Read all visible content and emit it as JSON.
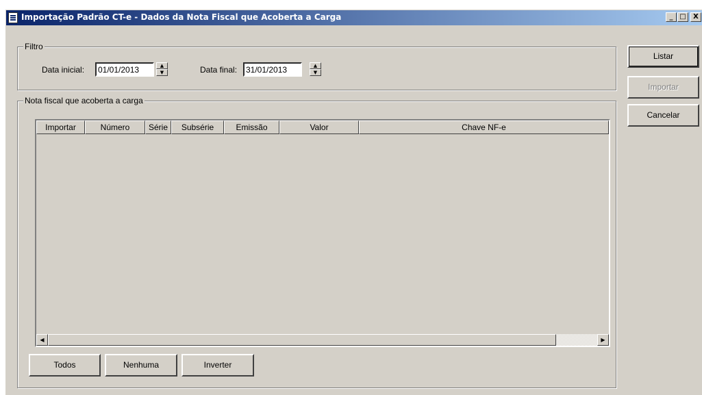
{
  "window": {
    "title": "Importação Padrão CT-e - Dados da Nota Fiscal que Acoberta a Carga",
    "minimize_label": "_",
    "maximize_label": "□",
    "close_label": "X"
  },
  "filtro": {
    "group_label": "Filtro",
    "data_inicial_label": "Data inicial:",
    "data_inicial_value": "01/01/2013",
    "data_final_label": "Data final:",
    "data_final_value": "31/01/2013"
  },
  "nota": {
    "group_label": "Nota fiscal que acoberta a carga",
    "columns": [
      "Importar",
      "Número",
      "Série",
      "Subsérie",
      "Emissão",
      "Valor",
      "Chave NF-e"
    ],
    "rows": []
  },
  "buttons": {
    "listar": "Listar",
    "importar": "Importar",
    "cancelar": "Cancelar",
    "todos": "Todos",
    "nenhuma": "Nenhuma",
    "inverter": "Inverter"
  }
}
